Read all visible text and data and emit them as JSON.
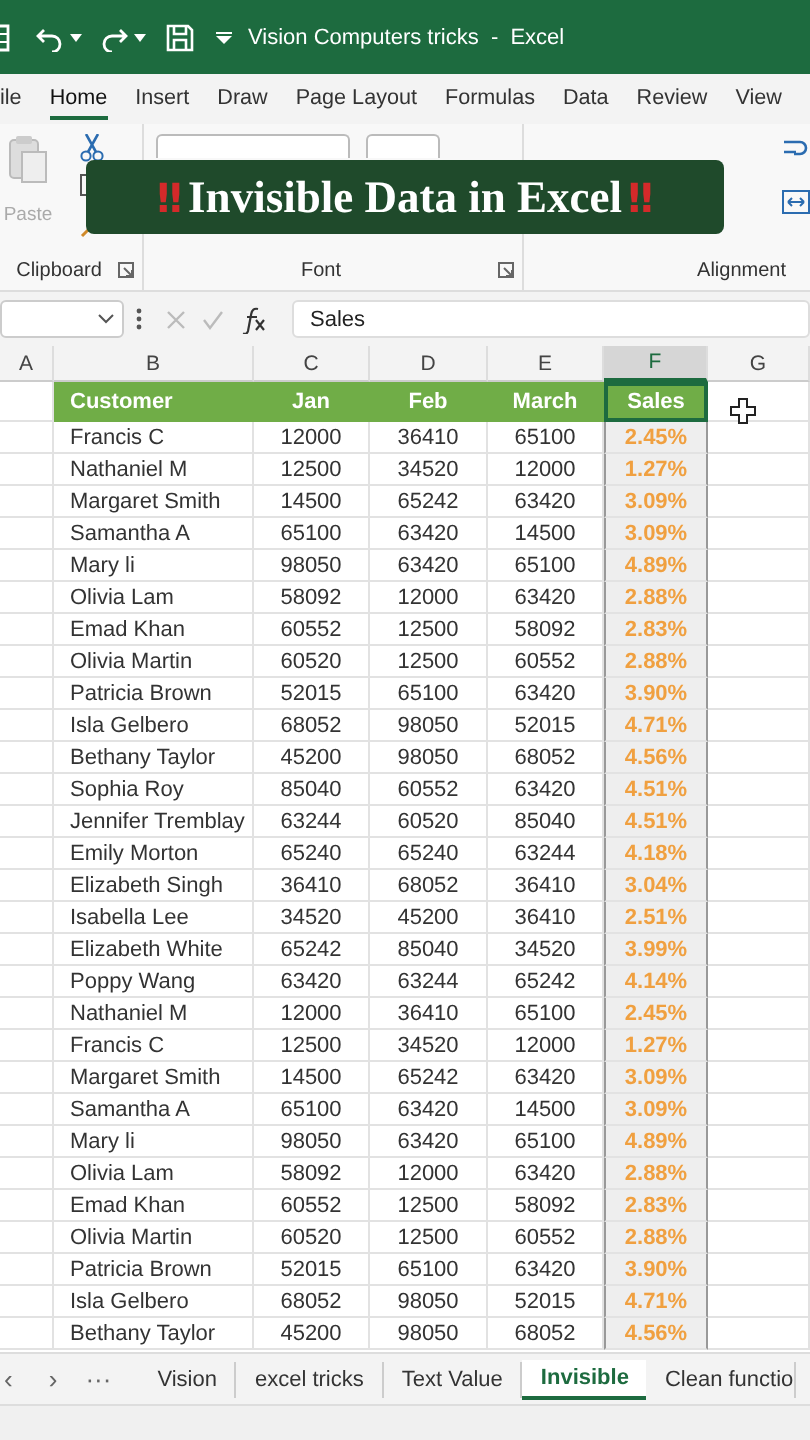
{
  "title_bar": {
    "title": "Vision Computers tricks  -  Excel"
  },
  "ribbon_tabs": [
    {
      "label": "ile",
      "selected": false
    },
    {
      "label": "Home",
      "selected": true
    },
    {
      "label": "Insert",
      "selected": false
    },
    {
      "label": "Draw",
      "selected": false
    },
    {
      "label": "Page Layout",
      "selected": false
    },
    {
      "label": "Formulas",
      "selected": false
    },
    {
      "label": "Data",
      "selected": false
    },
    {
      "label": "Review",
      "selected": false
    },
    {
      "label": "View",
      "selected": false
    }
  ],
  "ribbon": {
    "paste_label": "Paste",
    "groups": [
      "Clipboard",
      "Font",
      "Alignment"
    ]
  },
  "banner": {
    "lead": "‼",
    "text": "Invisible Data in Excel",
    "trail": "‼"
  },
  "formula_bar": {
    "formula": "Sales"
  },
  "column_headers": [
    {
      "label": "A",
      "selected": false
    },
    {
      "label": "B",
      "selected": false
    },
    {
      "label": "C",
      "selected": false
    },
    {
      "label": "D",
      "selected": false
    },
    {
      "label": "E",
      "selected": false
    },
    {
      "label": "F",
      "selected": true
    },
    {
      "label": "G",
      "selected": false
    }
  ],
  "table": {
    "columns": [
      {
        "label": "Customer",
        "selected": false
      },
      {
        "label": "Jan",
        "selected": false
      },
      {
        "label": "Feb",
        "selected": false
      },
      {
        "label": "March",
        "selected": false
      },
      {
        "label": "Sales",
        "selected": true
      }
    ],
    "rows": [
      [
        "Francis C",
        "12000",
        "36410",
        "65100",
        "2.45%"
      ],
      [
        "Nathaniel M",
        "12500",
        "34520",
        "12000",
        "1.27%"
      ],
      [
        "Margaret Smith",
        "14500",
        "65242",
        "63420",
        "3.09%"
      ],
      [
        "Samantha A",
        "65100",
        "63420",
        "14500",
        "3.09%"
      ],
      [
        "Mary li",
        "98050",
        "63420",
        "65100",
        "4.89%"
      ],
      [
        "Olivia Lam",
        "58092",
        "12000",
        "63420",
        "2.88%"
      ],
      [
        "Emad Khan",
        "60552",
        "12500",
        "58092",
        "2.83%"
      ],
      [
        "Olivia Martin",
        "60520",
        "12500",
        "60552",
        "2.88%"
      ],
      [
        "Patricia Brown",
        "52015",
        "65100",
        "63420",
        "3.90%"
      ],
      [
        "Isla Gelbero",
        "68052",
        "98050",
        "52015",
        "4.71%"
      ],
      [
        "Bethany Taylor",
        "45200",
        "98050",
        "68052",
        "4.56%"
      ],
      [
        "Sophia Roy",
        "85040",
        "60552",
        "63420",
        "4.51%"
      ],
      [
        "Jennifer Tremblay",
        "63244",
        "60520",
        "85040",
        "4.51%"
      ],
      [
        "Emily Morton",
        "65240",
        "65240",
        "63244",
        "4.18%"
      ],
      [
        "Elizabeth Singh",
        "36410",
        "68052",
        "36410",
        "3.04%"
      ],
      [
        "Isabella Lee",
        "34520",
        "45200",
        "36410",
        "2.51%"
      ],
      [
        "Elizabeth White",
        "65242",
        "85040",
        "34520",
        "3.99%"
      ],
      [
        "Poppy Wang",
        "63420",
        "63244",
        "65242",
        "4.14%"
      ],
      [
        "Nathaniel M",
        "12000",
        "36410",
        "65100",
        "2.45%"
      ],
      [
        "Francis C",
        "12500",
        "34520",
        "12000",
        "1.27%"
      ],
      [
        "Margaret Smith",
        "14500",
        "65242",
        "63420",
        "3.09%"
      ],
      [
        "Samantha A",
        "65100",
        "63420",
        "14500",
        "3.09%"
      ],
      [
        "Mary li",
        "98050",
        "63420",
        "65100",
        "4.89%"
      ],
      [
        "Olivia Lam",
        "58092",
        "12000",
        "63420",
        "2.88%"
      ],
      [
        "Emad Khan",
        "60552",
        "12500",
        "58092",
        "2.83%"
      ],
      [
        "Olivia Martin",
        "60520",
        "12500",
        "60552",
        "2.88%"
      ],
      [
        "Patricia Brown",
        "52015",
        "65100",
        "63420",
        "3.90%"
      ],
      [
        "Isla Gelbero",
        "68052",
        "98050",
        "52015",
        "4.71%"
      ],
      [
        "Bethany Taylor",
        "45200",
        "98050",
        "68052",
        "4.56%"
      ]
    ]
  },
  "sheet_tabs": {
    "nav": [
      "‹",
      "›",
      "···"
    ],
    "tabs": [
      {
        "label": "Vision",
        "selected": false
      },
      {
        "label": "excel tricks",
        "selected": false
      },
      {
        "label": "Text Value",
        "selected": false
      },
      {
        "label": "Invisible",
        "selected": true
      },
      {
        "label": "Clean functio",
        "selected": false
      }
    ]
  }
}
